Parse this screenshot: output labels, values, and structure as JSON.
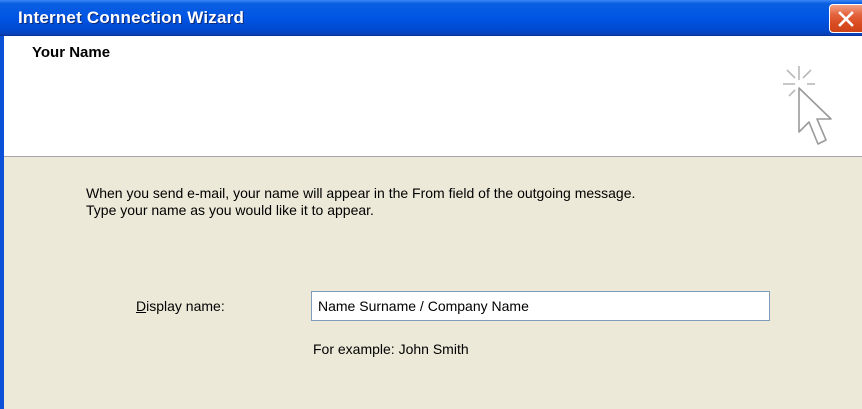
{
  "window": {
    "title": "Internet Connection Wizard",
    "close_icon": "close-icon",
    "accent_color": "#0055e5",
    "close_color": "#d94b20"
  },
  "header": {
    "title": "Your Name",
    "icon": "wizard-cursor-icon"
  },
  "body": {
    "instruction_line1": "When you send e-mail, your name will appear in the From field of the outgoing message.",
    "instruction_line2": "Type your name as you would like it to appear.",
    "display_name_label_mnemonic": "D",
    "display_name_label_rest": "isplay name:",
    "display_name_value": "Name Surname / Company Name",
    "example_text": "For example: John Smith",
    "background_color": "#ece9d8"
  }
}
